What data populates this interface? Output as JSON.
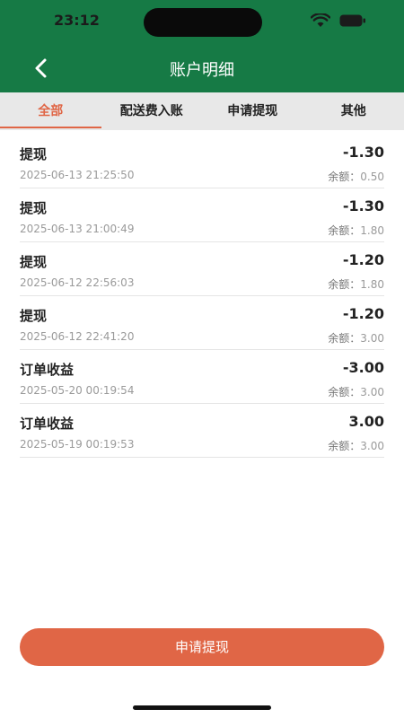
{
  "status_bar": {
    "time": "23:12"
  },
  "header": {
    "title": "账户明细"
  },
  "tabs": [
    {
      "label": "全部",
      "active": true
    },
    {
      "label": "配送费入账",
      "active": false
    },
    {
      "label": "申请提现",
      "active": false
    },
    {
      "label": "其他",
      "active": false
    }
  ],
  "records": [
    {
      "title": "提现",
      "amount": "-1.30",
      "time": "2025-06-13 21:25:50",
      "balance_label": "余额：",
      "balance": "0.50"
    },
    {
      "title": "提现",
      "amount": "-1.30",
      "time": "2025-06-13 21:00:49",
      "balance_label": "余额：",
      "balance": "1.80"
    },
    {
      "title": "提现",
      "amount": "-1.20",
      "time": "2025-06-12 22:56:03",
      "balance_label": "余额：",
      "balance": "1.80"
    },
    {
      "title": "提现",
      "amount": "-1.20",
      "time": "2025-06-12 22:41:20",
      "balance_label": "余额：",
      "balance": "3.00"
    },
    {
      "title": "订单收益",
      "amount": "-3.00",
      "time": "2025-05-20 00:19:54",
      "balance_label": "余额：",
      "balance": "3.00"
    },
    {
      "title": "订单收益",
      "amount": "3.00",
      "time": "2025-05-19 00:19:53",
      "balance_label": "余额：",
      "balance": "3.00"
    }
  ],
  "footer": {
    "apply_label": "申请提现"
  },
  "colors": {
    "header_bg": "#167a45",
    "accent": "#e06646",
    "tab_bg": "#e8e8e8"
  }
}
